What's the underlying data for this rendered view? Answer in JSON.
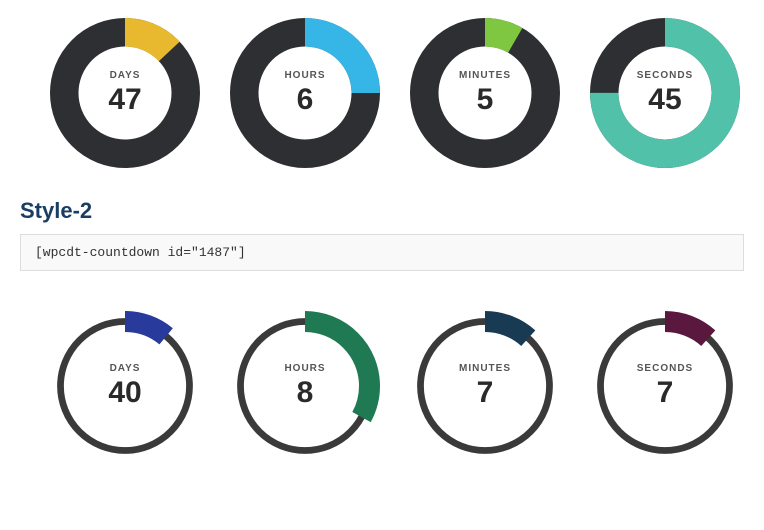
{
  "style1": {
    "ring_bg": "#2d2f33",
    "ring_width_ratio": 0.19,
    "items": [
      {
        "unit": "DAYS",
        "value": "47",
        "fraction": 0.13,
        "accent": "#e8b92f"
      },
      {
        "unit": "HOURS",
        "value": "6",
        "fraction": 0.25,
        "accent": "#35b6e6"
      },
      {
        "unit": "MINUTES",
        "value": "5",
        "fraction": 0.083,
        "accent": "#7fc641"
      },
      {
        "unit": "SECONDS",
        "value": "45",
        "fraction": 0.75,
        "accent": "#52c1a9"
      }
    ]
  },
  "section_title": "Style-2",
  "shortcode": "[wpcdt-countdown id=\"1487\"]",
  "style2": {
    "ring_bg": "#3a3a3a",
    "ring_width_ratio": 0.045,
    "arc_width_ratio": 0.14,
    "items": [
      {
        "unit": "DAYS",
        "value": "40",
        "fraction": 0.11,
        "accent": "#283a9c"
      },
      {
        "unit": "HOURS",
        "value": "8",
        "fraction": 0.33,
        "accent": "#1f7a53"
      },
      {
        "unit": "MINUTES",
        "value": "7",
        "fraction": 0.117,
        "accent": "#183a53"
      },
      {
        "unit": "SECONDS",
        "value": "7",
        "fraction": 0.117,
        "accent": "#5b183e"
      }
    ]
  }
}
